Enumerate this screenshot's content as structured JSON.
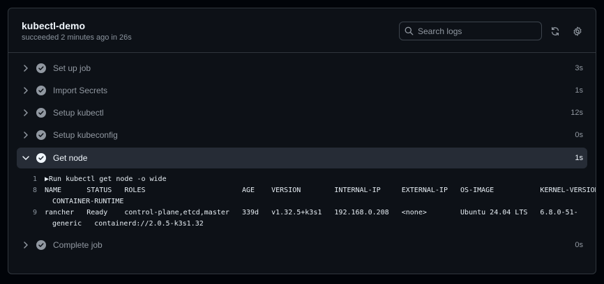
{
  "job": {
    "title": "kubectl-demo",
    "subtitle": "succeeded 2 minutes ago in 26s"
  },
  "search": {
    "placeholder": "Search logs"
  },
  "steps": [
    {
      "name": "Set up job",
      "duration": "3s",
      "expanded": false
    },
    {
      "name": "Import Secrets",
      "duration": "1s",
      "expanded": false
    },
    {
      "name": "Setup kubectl",
      "duration": "12s",
      "expanded": false
    },
    {
      "name": "Setup kubeconfig",
      "duration": "0s",
      "expanded": false
    },
    {
      "name": "Get node",
      "duration": "1s",
      "expanded": true
    },
    {
      "name": "Complete job",
      "duration": "0s",
      "expanded": false
    }
  ],
  "log": {
    "lines": [
      {
        "num": "1",
        "text": "▶Run kubectl get node -o wide",
        "cont": ""
      },
      {
        "num": "8",
        "text": "NAME      STATUS   ROLES                       AGE    VERSION        INTERNAL-IP     EXTERNAL-IP   OS-IMAGE           KERNEL-VERSION",
        "cont": "CONTAINER-RUNTIME"
      },
      {
        "num": "9",
        "text": "rancher   Ready    control-plane,etcd,master   339d   v1.32.5+k3s1   192.168.0.208   <none>        Ubuntu 24.04 LTS   6.8.0-51-",
        "cont": "generic   containerd://2.0.5-k3s1.32"
      }
    ]
  },
  "colors": {
    "success_check": "#9198a1",
    "active_check": "#f0f6fc"
  }
}
